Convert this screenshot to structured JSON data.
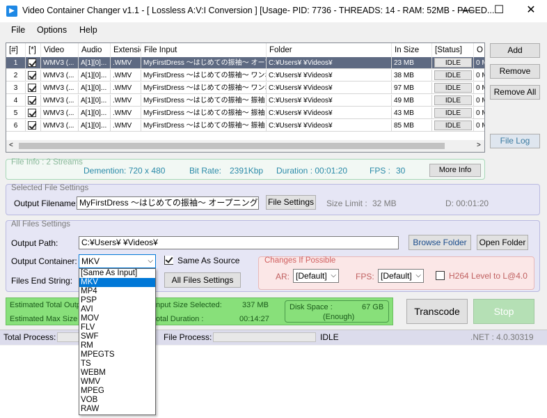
{
  "title": "Video Container Changer v1.1 - [ Lossless A:V:I Conversion ] [Usage- PID: 7736 - THREADS: 14 - RAM: 52MB - PAGED...",
  "window_controls": [
    "—",
    "☐",
    "✕"
  ],
  "menu": [
    "File",
    "Options",
    "Help"
  ],
  "grid": {
    "headers": [
      "[#]",
      "[*]",
      "Video",
      "Audio",
      "Extensio",
      "File Input",
      "Folder",
      "In Size",
      "[Status]",
      "O"
    ],
    "rows": [
      {
        "num": "1",
        "video": "WMV3 (...",
        "audio": "A[1][0]...",
        "ext": ".WMV",
        "input": "MyFirstDress ～はじめての振袖～ オープニ...",
        "folder": "C:¥Users¥      ¥Videos¥",
        "size": "23 MB",
        "status": "IDLE",
        "out": "0 M"
      },
      {
        "num": "2",
        "video": "WMV3 (...",
        "audio": "A[1][0]...",
        "ext": ".WMV",
        "input": "MyFirstDress ～はじめての振袖～ ワンポイ...",
        "folder": "C:¥Users¥      ¥Videos¥",
        "size": "38 MB",
        "status": "IDLE",
        "out": "0 M"
      },
      {
        "num": "3",
        "video": "WMV3 (...",
        "audio": "A[1][0]...",
        "ext": ".WMV",
        "input": "MyFirstDress ～はじめての振袖～ ワンポイ...",
        "folder": "C:¥Users¥      ¥Videos¥",
        "size": "97 MB",
        "status": "IDLE",
        "out": "0 M"
      },
      {
        "num": "4",
        "video": "WMV3 (...",
        "audio": "A[1][0]...",
        "ext": ".WMV",
        "input": "MyFirstDress ～はじめての振袖～ 振袖コレ...",
        "folder": "C:¥Users¥      ¥Videos¥",
        "size": "49 MB",
        "status": "IDLE",
        "out": "0 M"
      },
      {
        "num": "5",
        "video": "WMV3 (...",
        "audio": "A[1][0]...",
        "ext": ".WMV",
        "input": "MyFirstDress ～はじめての振袖～ 振袖コレ...",
        "folder": "C:¥Users¥      ¥Videos¥",
        "size": "43 MB",
        "status": "IDLE",
        "out": "0 M"
      },
      {
        "num": "6",
        "video": "WMV3 (...",
        "audio": "A[1][0]...",
        "ext": ".WMV",
        "input": "MyFirstDress ～はじめての振袖～ 振袖コレ...",
        "folder": "C:¥Users¥      ¥Videos¥",
        "size": "85 MB",
        "status": "IDLE",
        "out": "0 M"
      }
    ]
  },
  "side_buttons": {
    "add": "Add",
    "remove": "Remove",
    "remove_all": "Remove All",
    "file_log": "File Log"
  },
  "file_info": {
    "title": "File Info : 2 Streams",
    "dimension": "Demention: 720 x 480",
    "bitrate_label": "Bit Rate:",
    "bitrate": "2391Kbp",
    "duration": "Duration : 00:01:20",
    "fps_label": "FPS :",
    "fps": "30",
    "more_info": "More Info"
  },
  "selected": {
    "title": "Selected File Settings",
    "output_label": "Output Filename:",
    "output_value": "MyFirstDress ～はじめての振袖～ オープニング",
    "file_settings": "File Settings",
    "size_limit_label": "Size Limit :",
    "size_limit": "32 MB",
    "duration": "D: 00:01:20"
  },
  "all_files": {
    "title": "All Files Settings",
    "output_path_label": "Output Path:",
    "output_path": "C:¥Users¥      ¥Videos¥",
    "browse": "Browse Folder",
    "open": "Open Folder",
    "container_label": "Output Container:",
    "container_value": "MKV",
    "same_as_source": "Same As Source",
    "end_string_label": "Files End String:",
    "all_files_settings": "All Files Settings",
    "changes_title": "Changes If Possible",
    "ar_label": "AR:",
    "ar_value": "[Default]",
    "fps_label": "FPS:",
    "fps_value": "[Default]",
    "h264": "H264 Level to L@4.0"
  },
  "estimates": {
    "total_output": "Estimated Total Outp",
    "max_size": "Estimated Max Size Li",
    "input_size_label": "nput Size Selected:",
    "input_size": "337 MB",
    "total_duration_label": "otal Duration :",
    "total_duration": "00:14:27",
    "disk_label": "Disk Space :",
    "disk_value": "67 GB",
    "disk_note": "(Enough)"
  },
  "actions": {
    "transcode": "Transcode",
    "stop": "Stop"
  },
  "statusbar": {
    "total_label": "Total Process:",
    "file_label": "File Process:",
    "state": "IDLE",
    "net": ".NET :  4.0.30319"
  },
  "dropdown": {
    "options": [
      "[Same As Input]",
      "MKV",
      "MP4",
      "PSP",
      "AVI",
      "MOV",
      "FLV",
      "SWF",
      "RM",
      "MPEGTS",
      "TS",
      "WEBM",
      "WMV",
      "MPEG",
      "VOB",
      "RAW"
    ],
    "selected": "MKV"
  },
  "colors": {
    "selected_row": "#5e6a82",
    "accent": "#0078d7",
    "file_info_text": "#2a8aa8",
    "group_bg": "#e6e6f5",
    "changes_bg": "#fbe7e7",
    "estimate_bg": "#88e07a"
  }
}
